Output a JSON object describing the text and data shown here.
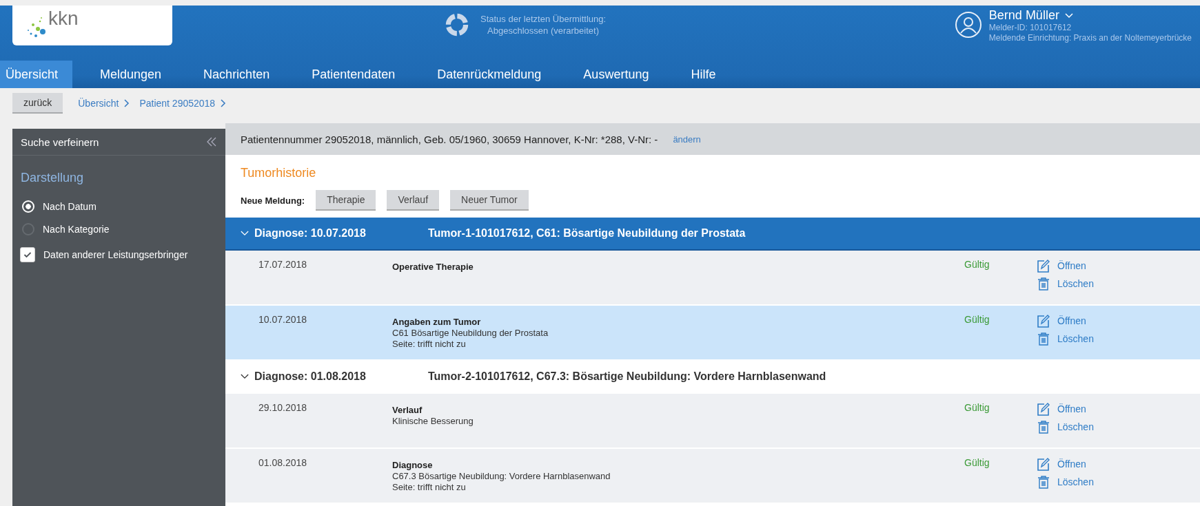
{
  "logo": {
    "text": "kkn"
  },
  "status": {
    "label": "Status der letzten Übermittlung:",
    "value": "Abgeschlossen (verarbeitet)"
  },
  "user": {
    "name": "Bernd Müller",
    "id": "Melder-ID: 101017612",
    "facility": "Meldende Einrichtung: Praxis an der Noltemeyerbrücke"
  },
  "tabs": [
    {
      "label": "Übersicht",
      "selected": true
    },
    {
      "label": "Meldungen",
      "selected": false
    },
    {
      "label": "Nachrichten",
      "selected": false
    },
    {
      "label": "Patientendaten",
      "selected": false
    },
    {
      "label": "Datenrückmeldung",
      "selected": false
    },
    {
      "label": "Auswertung",
      "selected": false
    },
    {
      "label": "Hilfe",
      "selected": false
    }
  ],
  "back_button": "zurück",
  "breadcrumb": [
    "Übersicht",
    "Patient 29052018"
  ],
  "sidebar": {
    "title": "Suche verfeinern",
    "section": "Darstellung",
    "radios": [
      {
        "label": "Nach Datum",
        "selected": true
      },
      {
        "label": "Nach Kategorie",
        "selected": false
      }
    ],
    "checkbox": {
      "label": "Daten anderer Leistungserbringer",
      "checked": true
    }
  },
  "patient": {
    "info": "Patientennummer 29052018, männlich, Geb. 05/1960, 30659 Hannover, K-Nr: *288, V-Nr: -",
    "edit_link": "ändern"
  },
  "section_title": "Tumorhistorie",
  "new_report": {
    "label": "Neue Meldung:",
    "buttons": [
      "Therapie",
      "Verlauf",
      "Neuer Tumor"
    ]
  },
  "diagnoses": [
    {
      "date": "Diagnose: 10.07.2018",
      "tumor": "Tumor-1-101017612, C61: Bösartige Neubildung der Prostata",
      "expanded": true,
      "selected": true,
      "rows": [
        {
          "date": "17.07.2018",
          "title": "Operative Therapie",
          "lines": [],
          "status": "Gültig",
          "open": "Öffnen",
          "delete": "Löschen",
          "selected": false
        },
        {
          "date": "10.07.2018",
          "title": "Angaben zum Tumor",
          "lines": [
            "C61 Bösartige Neubildung der Prostata",
            "Seite: trifft nicht zu"
          ],
          "status": "Gültig",
          "open": "Öffnen",
          "delete": "Löschen",
          "selected": true
        }
      ]
    },
    {
      "date": "Diagnose: 01.08.2018",
      "tumor": "Tumor-2-101017612, C67.3: Bösartige Neubildung: Vordere Harnblasenwand",
      "expanded": true,
      "selected": false,
      "rows": [
        {
          "date": "29.10.2018",
          "title": "Verlauf",
          "lines": [
            "Klinische Besserung"
          ],
          "status": "Gültig",
          "open": "Öffnen",
          "delete": "Löschen",
          "selected": false
        },
        {
          "date": "01.08.2018",
          "title": "Diagnose",
          "lines": [
            "C67.3 Bösartige Neubildung: Vordere Harnblasenwand",
            "Seite: trifft nicht zu"
          ],
          "status": "Gültig",
          "open": "Öffnen",
          "delete": "Löschen",
          "selected": false
        }
      ]
    }
  ]
}
